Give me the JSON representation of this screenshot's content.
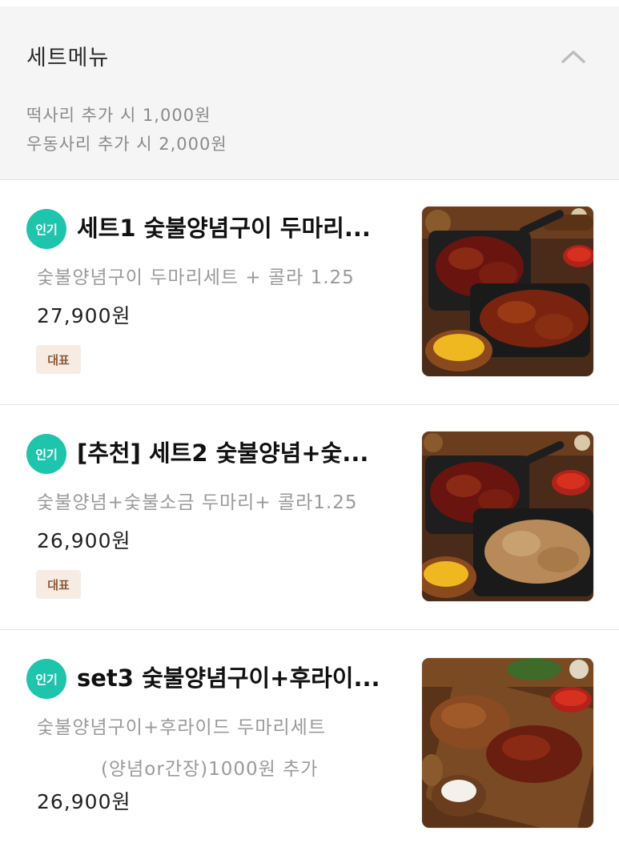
{
  "section": {
    "title": "세트메뉴",
    "notes": [
      "떡사리 추가 시 1,000원",
      "우동사리 추가 시 2,000원"
    ]
  },
  "items": [
    {
      "popular_badge": "인기",
      "name": "세트1 숯불양념구이 두마리...",
      "description_line1": "숯불양념구이 두마리세트 + 콜라 1.25",
      "description_line2": "",
      "price": "27,900원",
      "tag": "대표"
    },
    {
      "popular_badge": "인기",
      "name": "[추천] 세트2 숯불양념+숯...",
      "description_line1": "숯불양념+숯불소금 두마리+ 콜라1.25",
      "description_line2": "",
      "price": "26,900원",
      "tag": "대표"
    },
    {
      "popular_badge": "인기",
      "name": "set3 숯불양념구이+후라이...",
      "description_line1": "숯불양념구이+후라이드 두마리세트",
      "description_line2": "(양념or간장)1000원 추가",
      "price": "26,900원",
      "tag": ""
    }
  ],
  "colors": {
    "popular_badge_bg": "#1fc4ad",
    "rep_badge_bg": "#f6ece4",
    "rep_badge_text": "#8c5a36",
    "header_bg": "#f5f5f5"
  },
  "icons": {
    "collapse": "chevron-up-icon"
  }
}
